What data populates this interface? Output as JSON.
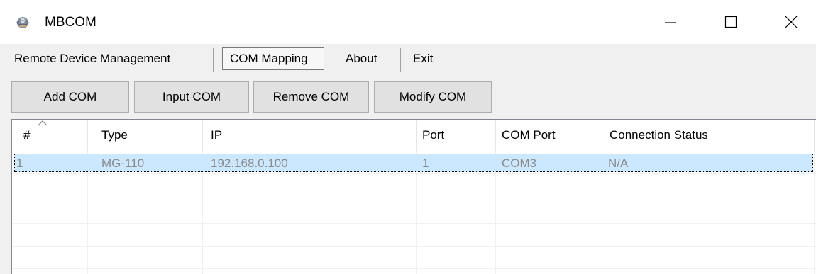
{
  "window": {
    "title": "MBCOM",
    "app_icon": "globe-user-icon"
  },
  "menu": {
    "items": [
      {
        "label": "Remote Device Management"
      },
      {
        "label": "COM Mapping"
      },
      {
        "label": "About"
      },
      {
        "label": "Exit"
      }
    ]
  },
  "toolbar": {
    "buttons": [
      {
        "label": "Add COM"
      },
      {
        "label": "Input COM"
      },
      {
        "label": "Remove COM"
      },
      {
        "label": "Modify COM"
      }
    ]
  },
  "table": {
    "columns": [
      "#",
      "Type",
      "IP",
      "Port",
      "COM Port",
      "Connection Status"
    ],
    "rows": [
      {
        "num": "1",
        "type": "MG-110",
        "ip": "192.168.0.100",
        "port": "1",
        "com_port": "COM3",
        "status": "N/A"
      }
    ],
    "selected_row": 0,
    "sort_column": "#"
  },
  "colors": {
    "selection": "#cce8ff",
    "button_face": "#e1e1e1",
    "window_bg": "#f0f0f0"
  }
}
